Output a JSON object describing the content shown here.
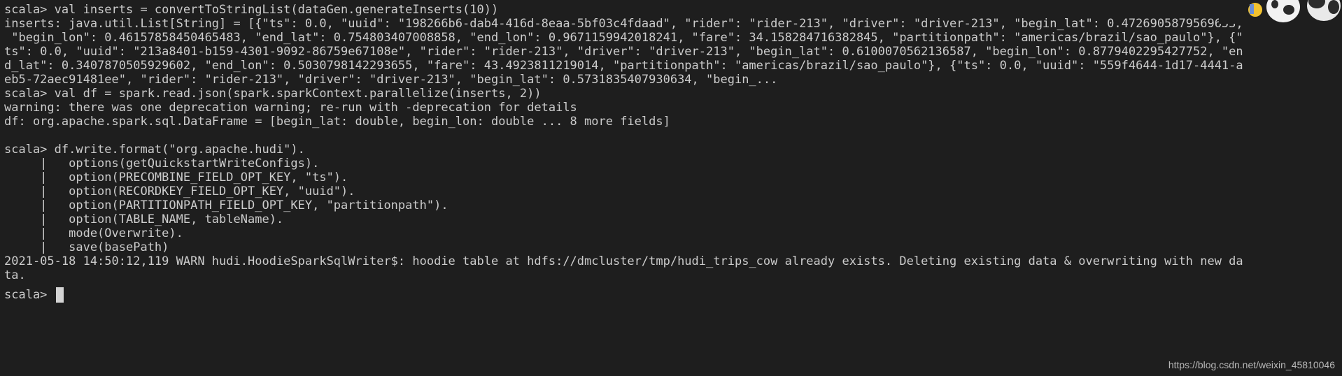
{
  "terminal": {
    "lines": [
      "scala> val inserts = convertToStringList(dataGen.generateInserts(10))",
      "inserts: java.util.List[String] = [{\"ts\": 0.0, \"uuid\": \"198266b6-dab4-416d-8eaa-5bf03c4fdaad\", \"rider\": \"rider-213\", \"driver\": \"driver-213\", \"begin_lat\": 0.4726905879569653,",
      " \"begin_lon\": 0.46157858450465483, \"end_lat\": 0.754803407008858, \"end_lon\": 0.9671159942018241, \"fare\": 34.158284716382845, \"partitionpath\": \"americas/brazil/sao_paulo\"}, {\"",
      "ts\": 0.0, \"uuid\": \"213a8401-b159-4301-9092-86759e67108e\", \"rider\": \"rider-213\", \"driver\": \"driver-213\", \"begin_lat\": 0.6100070562136587, \"begin_lon\": 0.8779402295427752, \"en",
      "d_lat\": 0.3407870505929602, \"end_lon\": 0.5030798142293655, \"fare\": 43.4923811219014, \"partitionpath\": \"americas/brazil/sao_paulo\"}, {\"ts\": 0.0, \"uuid\": \"559f4644-1d17-4441-a",
      "eb5-72aec91481ee\", \"rider\": \"rider-213\", \"driver\": \"driver-213\", \"begin_lat\": 0.5731835407930634, \"begin_...",
      "scala> val df = spark.read.json(spark.sparkContext.parallelize(inserts, 2))",
      "warning: there was one deprecation warning; re-run with -deprecation for details",
      "df: org.apache.spark.sql.DataFrame = [begin_lat: double, begin_lon: double ... 8 more fields]",
      "",
      "scala> df.write.format(\"org.apache.hudi\").",
      "     |   options(getQuickstartWriteConfigs).",
      "     |   option(PRECOMBINE_FIELD_OPT_KEY, \"ts\").",
      "     |   option(RECORDKEY_FIELD_OPT_KEY, \"uuid\").",
      "     |   option(PARTITIONPATH_FIELD_OPT_KEY, \"partitionpath\").",
      "     |   option(TABLE_NAME, tableName).",
      "     |   mode(Overwrite).",
      "     |   save(basePath)",
      "2021-05-18 14:50:12,119 WARN hudi.HoodieSparkSqlWriter$: hoodie table at hdfs://dmcluster/tmp/hudi_trips_cow already exists. Deleting existing data & overwriting with new da",
      "ta.",
      ""
    ],
    "prompt": "scala> "
  },
  "watermark": "https://blog.csdn.net/weixin_45810046",
  "colors": {
    "background": "#1e1e1e",
    "text": "#cccccc",
    "cursor": "#d4d4d4"
  }
}
